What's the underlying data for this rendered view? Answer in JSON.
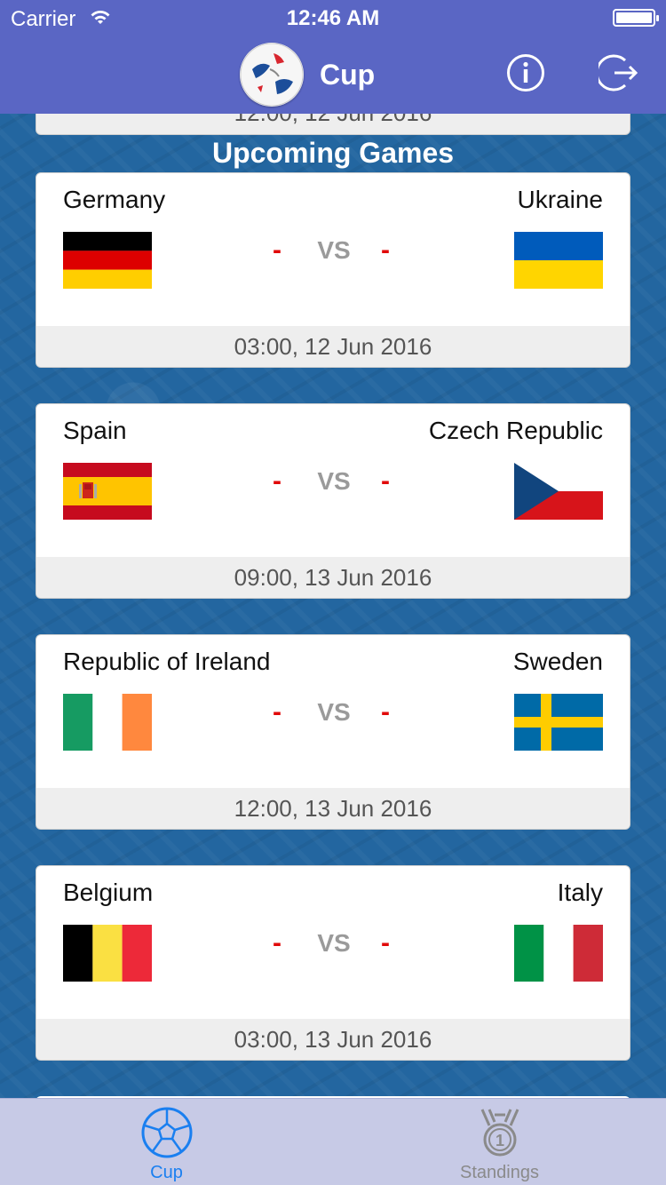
{
  "status_bar": {
    "carrier": "Carrier",
    "time": "12:46 AM"
  },
  "nav": {
    "title": "Cup"
  },
  "section_title": "Upcoming Games",
  "previous_card_time": "12:00, 12 Jun 2016",
  "vs_label": "VS",
  "score_placeholder": "-",
  "games": [
    {
      "home": "Germany",
      "away": "Ukraine",
      "time": "03:00, 12 Jun 2016"
    },
    {
      "home": "Spain",
      "away": "Czech Republic",
      "time": "09:00, 13 Jun 2016"
    },
    {
      "home": "Republic of Ireland",
      "away": "Sweden",
      "time": "12:00, 13 Jun 2016"
    },
    {
      "home": "Belgium",
      "away": "Italy",
      "time": "03:00, 13 Jun 2016"
    }
  ],
  "tabs": [
    {
      "label": "Cup",
      "selected": true,
      "icon": "soccer-ball-icon"
    },
    {
      "label": "Standings",
      "selected": false,
      "icon": "medal-icon"
    }
  ],
  "colors": {
    "nav_bar": "#5a66c4",
    "score_red": "#e10a0a",
    "tab_selected": "#1a7ff0",
    "tab_unselected": "#8a8a8a"
  }
}
